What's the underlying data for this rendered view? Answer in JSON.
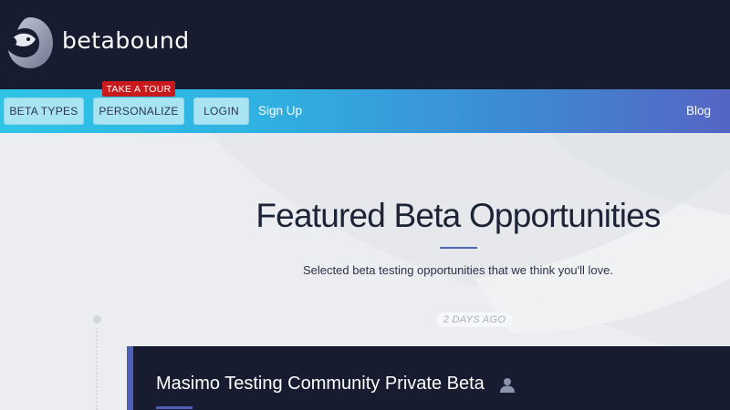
{
  "brand": {
    "name": "betabound",
    "logo_icon": "fish-logo-icon"
  },
  "nav": {
    "buttons": [
      {
        "label": "BETA TYPES"
      },
      {
        "label": "PERSONALIZE"
      },
      {
        "label": "LOGIN"
      }
    ],
    "tour_badge": "TAKE A TOUR",
    "signup": "Sign Up",
    "blog": "Blog"
  },
  "hero": {
    "title": "Featured Beta Opportunities",
    "subtitle": "Selected beta testing opportunities that we think you'll love."
  },
  "feed": {
    "timestamp": "2 DAYS AGO",
    "items": [
      {
        "title": "Masimo Testing Community Private Beta",
        "icon": "private-user-icon"
      }
    ]
  },
  "colors": {
    "header_bg": "#171c30",
    "nav_gradient_start": "#2fc4e6",
    "nav_gradient_end": "#5565c4",
    "tour_badge": "#c8191c",
    "accent": "#4e5fb6"
  }
}
